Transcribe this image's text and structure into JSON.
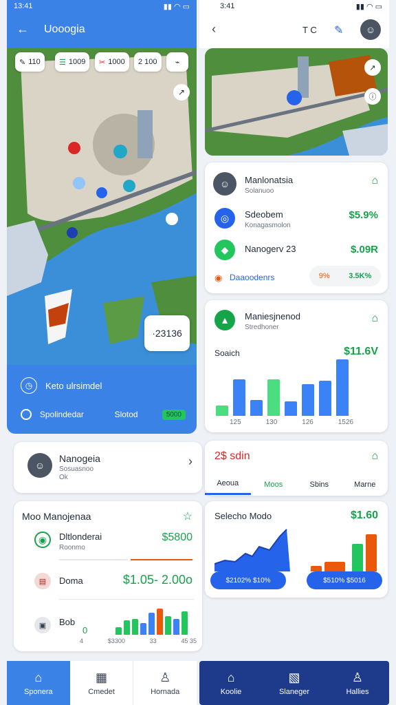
{
  "left": {
    "status_time": "13:41",
    "header_title": "Uooogia",
    "map_pills": [
      "110",
      "1009",
      "1000",
      "2 100"
    ],
    "map_price_tag": "·23136",
    "blue_panel": {
      "title": "Keto ulrsimdel",
      "row_label": "Spolindedar",
      "row_value": "Slotod",
      "badge": "5000"
    },
    "profile": {
      "name": "Nanogeia",
      "sub1": "Sosuasnoo",
      "sub2": "Ok"
    },
    "manager": {
      "title": "Moo Manojenaa",
      "item1": {
        "label": "Dltlonderai",
        "sub": "Roonmo",
        "value": "$5800"
      },
      "item2": {
        "label": "Doma",
        "value": "$1.05- 2.00o"
      },
      "item3": {
        "label": "Bob",
        "value": "0",
        "xlabels": [
          "4",
          "$3300",
          "33",
          "45 35"
        ]
      },
      "mini_bars": [
        0.3,
        0.55,
        0.6,
        0.45,
        0.85,
        1.0,
        0.7,
        0.6,
        0.9
      ]
    },
    "nav": [
      {
        "label": "Sponera",
        "icon": "home-icon"
      },
      {
        "label": "Cmedet",
        "icon": "chart-icon"
      },
      {
        "label": "Hornada",
        "icon": "user-icon"
      }
    ]
  },
  "right": {
    "status_time": "3:41",
    "top_text": "T C",
    "card1": {
      "person": {
        "name": "Manlonatsia",
        "sub": "Solanuoo"
      },
      "row1": {
        "label": "Sdeobem",
        "sub": "Konagasmolon",
        "value": "$5.9%"
      },
      "row2": {
        "label": "Nanogerv 23",
        "value": "$.09R"
      },
      "footer_label": "Daaoodenrs",
      "footer_pct": "9%",
      "footer_value": "3.5K%"
    },
    "card2": {
      "title": "Maniesjnenod",
      "sub": "Stredhoner",
      "label": "Soaich",
      "value": "$11.6V",
      "xlabels": [
        "125",
        "130",
        "126",
        "1526"
      ]
    },
    "card3": {
      "title": "2$ sdin",
      "tabs": [
        "Aeoua",
        "Moos",
        "Sbins",
        "Marne"
      ]
    },
    "card4": {
      "title": "Selecho Modo",
      "value": "$1.60",
      "chips": [
        "$2102% $10%",
        "$510% $5016"
      ]
    },
    "nav": [
      {
        "label": "Koolie",
        "icon": "home-icon"
      },
      {
        "label": "Slaneger",
        "icon": "card-icon"
      },
      {
        "label": "Hallies",
        "icon": "user-icon"
      }
    ]
  },
  "chart_data": [
    {
      "type": "bar",
      "categories": [
        "1",
        "2",
        "3",
        "4",
        "5",
        "6",
        "7",
        "8"
      ],
      "values": [
        15,
        52,
        22,
        52,
        20,
        45,
        50,
        80
      ],
      "title": "",
      "xlabel": "",
      "ylabel": ""
    }
  ]
}
